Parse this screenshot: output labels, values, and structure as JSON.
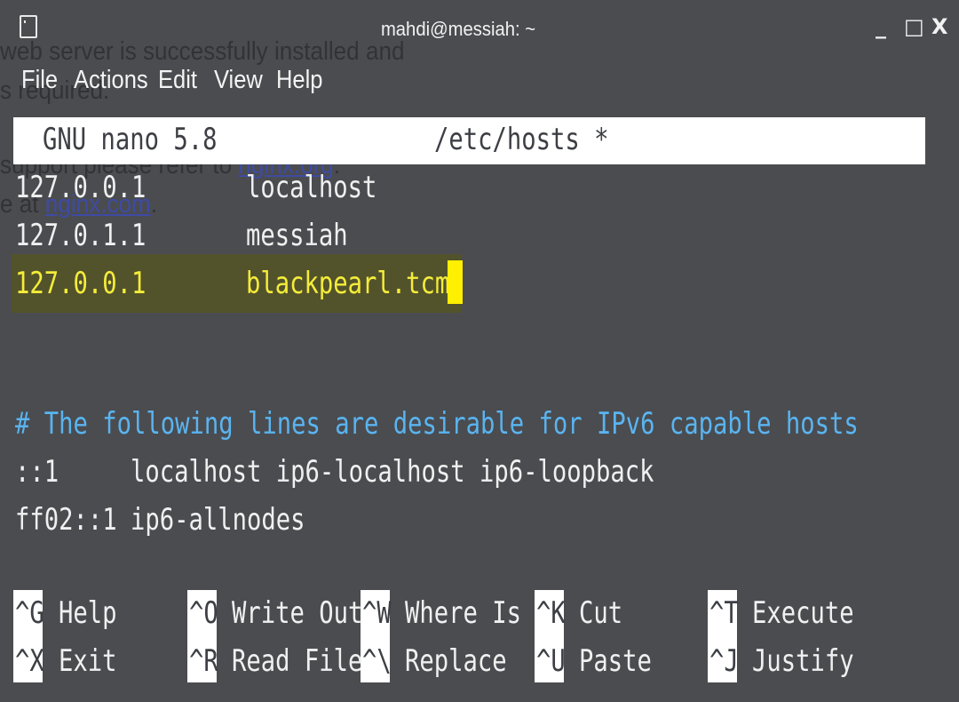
{
  "window": {
    "title": "mahdi@messiah: ~",
    "minimize_label": "_",
    "maximize_label": "□",
    "close_label": "X"
  },
  "background_window": {
    "line1": "web server is successfully installed and",
    "line2": "s required.",
    "line3_prefix": "support please refer to ",
    "line3_link": "nginx.org",
    "line3_suffix": ".",
    "line4_prefix": "e at ",
    "line4_link": "nginx.com",
    "line4_suffix": "."
  },
  "menu": [
    "File",
    "Actions",
    "Edit",
    "View",
    "Help"
  ],
  "nano": {
    "version": "GNU nano 5.8",
    "filename": "/etc/hosts *"
  },
  "hosts": [
    {
      "ip": "127.0.0.1",
      "name": "localhost"
    },
    {
      "ip": "127.0.1.1",
      "name": "messiah"
    },
    {
      "ip": "127.0.0.1",
      "name": "blackpearl.tcm"
    }
  ],
  "comment": "# The following lines are desirable for IPv6 capable hosts",
  "ipv6": [
    {
      "addr": "::1",
      "names": "localhost ip6-localhost ip6-loopback"
    },
    {
      "addr": "ff02::1",
      "names": "ip6-allnodes"
    }
  ],
  "shortcuts": {
    "row1": [
      {
        "key": "^G",
        "label": "Help"
      },
      {
        "key": "^O",
        "label": "Write Out"
      },
      {
        "key": "^W",
        "label": "Where Is"
      },
      {
        "key": "^K",
        "label": "Cut"
      },
      {
        "key": "^T",
        "label": "Execute"
      }
    ],
    "row2": [
      {
        "key": "^X",
        "label": "Exit"
      },
      {
        "key": "^R",
        "label": "Read File"
      },
      {
        "key": "^\\",
        "label": "Replace"
      },
      {
        "key": "^U",
        "label": "Paste"
      },
      {
        "key": "^J",
        "label": "Justify"
      }
    ]
  },
  "colors": {
    "background": "#4a4c50",
    "header_bg": "#ffffff",
    "highlight_text": "#f5ec3a",
    "cursor": "#ffef00",
    "comment": "#5ab4f0"
  },
  "icons": {
    "terminal": "terminal-icon",
    "minimize": "minimize-icon",
    "maximize": "maximize-icon",
    "close": "close-icon"
  }
}
